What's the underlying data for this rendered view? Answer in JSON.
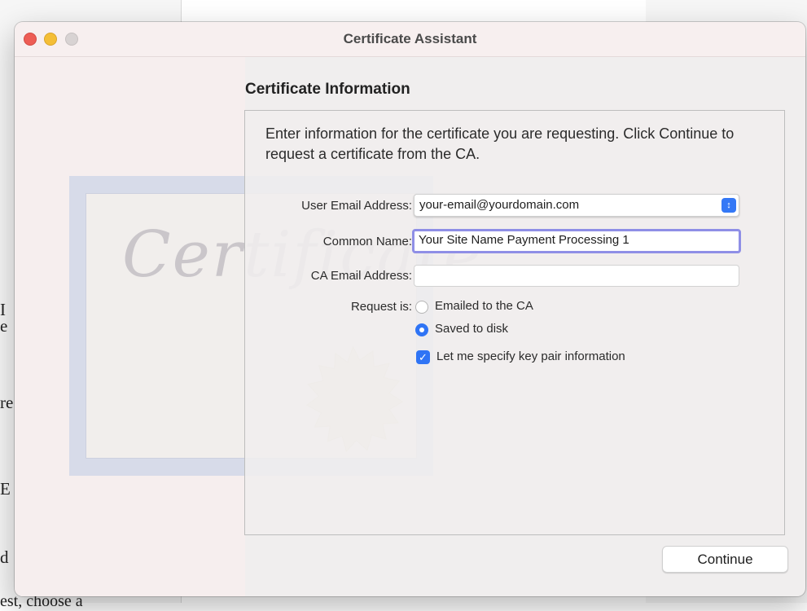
{
  "window": {
    "title": "Certificate Assistant"
  },
  "background_doc": {
    "snippets": [
      "I",
      "e",
      "re",
      "E",
      "d",
      "est, choose a"
    ]
  },
  "certificate_graphic": {
    "word": "Certificate"
  },
  "section": {
    "heading": "Certificate Information",
    "intro": "Enter information for the certificate you are requesting. Click Continue to request a certificate from the CA."
  },
  "form": {
    "user_email": {
      "label": "User Email Address:",
      "value": "your-email@yourdomain.com"
    },
    "common_name": {
      "label": "Common Name:",
      "value": "Your Site Name Payment Processing 1"
    },
    "ca_email": {
      "label": "CA Email Address:",
      "value": ""
    },
    "request": {
      "label": "Request is:",
      "options": [
        {
          "label": "Emailed to the CA",
          "selected": false
        },
        {
          "label": "Saved to disk",
          "selected": true
        }
      ]
    },
    "key_pair": {
      "label": "Let me specify key pair information",
      "checked": true
    }
  },
  "buttons": {
    "continue": "Continue"
  },
  "colors": {
    "accent": "#2f74f5",
    "focus_ring": "#8f8fe6",
    "close": "#ed5d55",
    "minimize": "#f4be36"
  }
}
